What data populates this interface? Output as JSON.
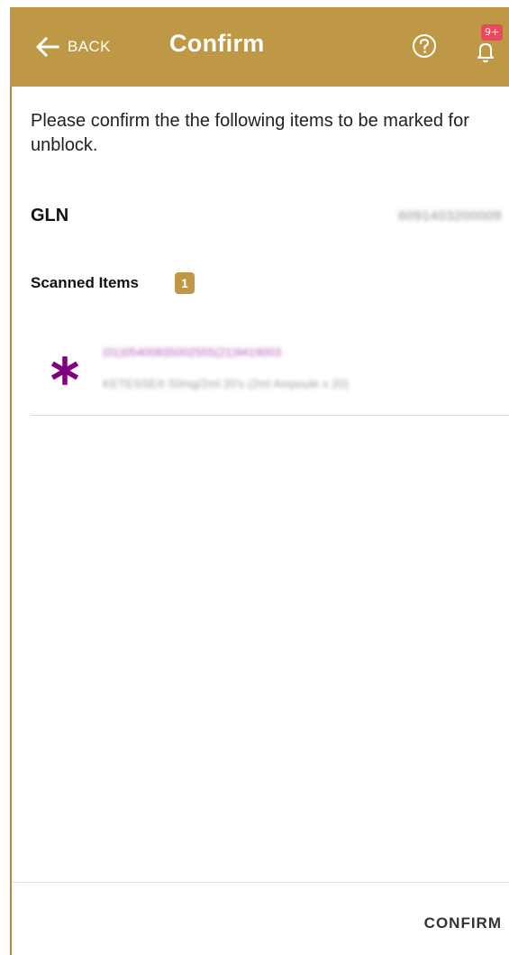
{
  "header": {
    "back_label": "BACK",
    "title": "Confirm",
    "notification_count": "9+",
    "background_color": "#bf9845"
  },
  "intro_text": "Please confirm the the following items to be marked for unblock.",
  "gln": {
    "label": "GLN",
    "value": "6091403200009"
  },
  "scanned_items": {
    "label": "Scanned Items",
    "count": "1",
    "items": [
      {
        "code": "(01)05400835002555(21)9419003",
        "description": "KETESSE® 50mg/2ml 20's (2ml Ampoule x 20)",
        "icon": "asterisk-icon",
        "icon_color": "#800080"
      }
    ]
  },
  "footer": {
    "confirm_label": "CONFIRM"
  }
}
